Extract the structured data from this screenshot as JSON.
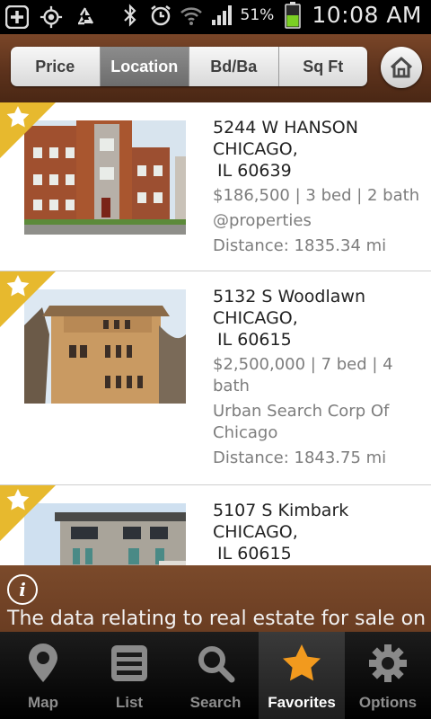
{
  "status_bar": {
    "battery_percent": "51%",
    "time": "10:08 AM",
    "icons": [
      "add-icon",
      "gps-icon",
      "recycle-icon",
      "bluetooth-icon",
      "alarm-icon",
      "wifi-icon",
      "signal-icon",
      "battery-icon"
    ]
  },
  "sort_bar": {
    "buttons": [
      {
        "label": "Price",
        "active": false
      },
      {
        "label": "Location",
        "active": true
      },
      {
        "label": "Bd/Ba",
        "active": false
      },
      {
        "label": "Sq Ft",
        "active": false
      }
    ],
    "home_icon": "home-icon"
  },
  "listings": [
    {
      "street": "5244 W HANSON",
      "city": "CHICAGO,",
      "state_zip": "IL 60639",
      "summary": "$186,500 | 3 bed | 2 bath",
      "agency": "@properties",
      "distance": "Distance: 1835.34 mi",
      "favorite": true
    },
    {
      "street": "5132 S Woodlawn",
      "city": "CHICAGO,",
      "state_zip": "IL 60615",
      "summary": "$2,500,000 | 7 bed | 4 bath",
      "agency": "Urban Search Corp Of Chicago",
      "distance": "Distance: 1843.75 mi",
      "favorite": true
    },
    {
      "street": "5107 S Kimbark",
      "city": "CHICAGO,",
      "state_zip": "IL 60615",
      "summary": "",
      "agency": "",
      "distance": "",
      "favorite": true
    }
  ],
  "disclaimer": {
    "text": "The data relating to real estate for sale on"
  },
  "tabs": [
    {
      "label": "Map",
      "icon": "map-pin-icon",
      "active": false
    },
    {
      "label": "List",
      "icon": "list-icon",
      "active": false
    },
    {
      "label": "Search",
      "icon": "search-icon",
      "active": false
    },
    {
      "label": "Favorites",
      "icon": "star-icon",
      "active": true
    },
    {
      "label": "Options",
      "icon": "gear-icon",
      "active": false
    }
  ],
  "colors": {
    "header_brown": "#5c321c",
    "disclaimer_brown": "#6a3d22",
    "favorite_orange": "#f29a1e",
    "ribbon_gold": "#e7b92e"
  }
}
